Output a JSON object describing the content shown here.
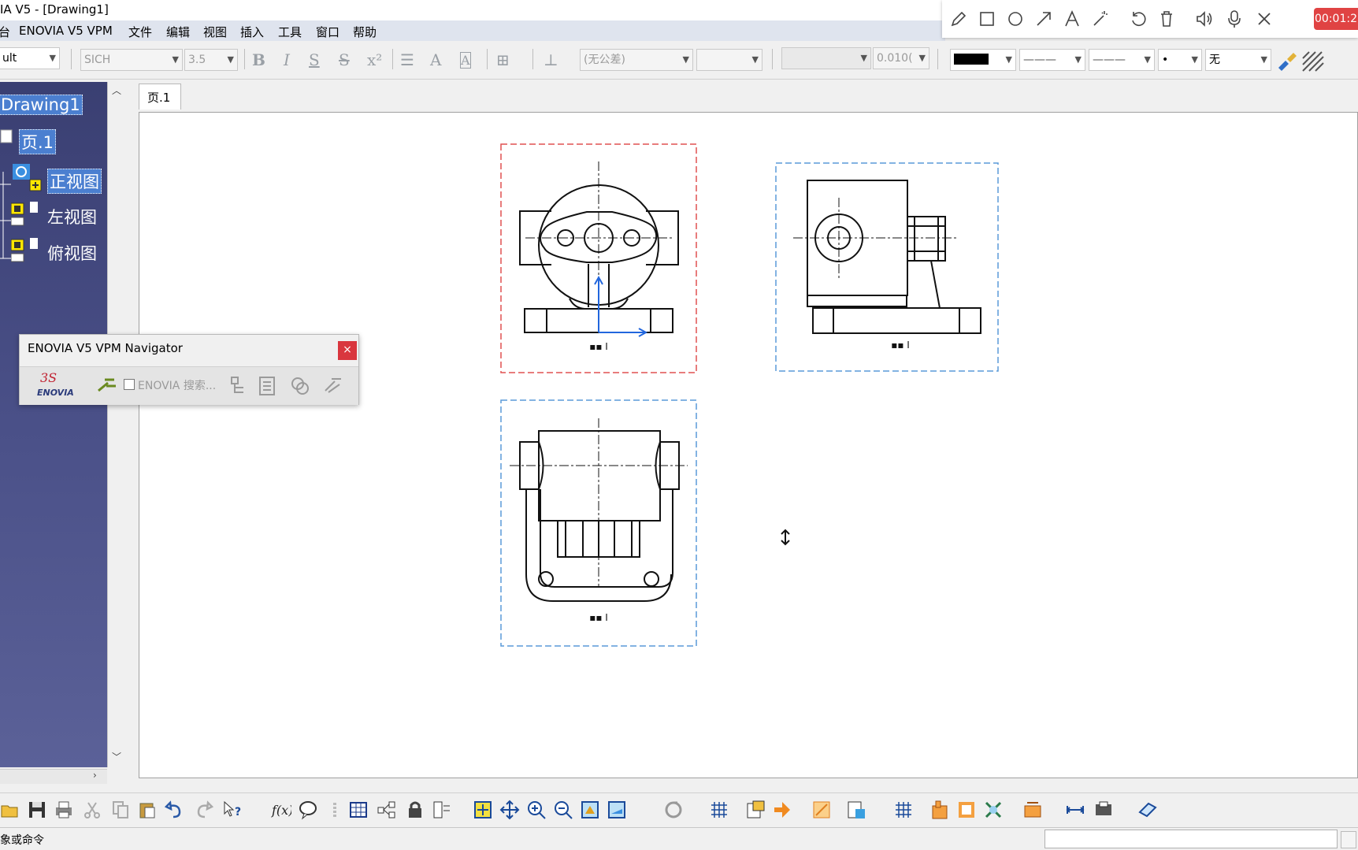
{
  "window": {
    "title": "IA V5 - [Drawing1]"
  },
  "menu": {
    "items": [
      "台",
      "ENOVIA V5 VPM",
      "文件",
      "编辑",
      "视图",
      "插入",
      "工具",
      "窗口",
      "帮助"
    ]
  },
  "recorder": {
    "timer": "00:01:2"
  },
  "format_toolbar": {
    "style_value": "ult",
    "font_name": "SICH",
    "font_size": "3.5",
    "tolerance": "(无公差)",
    "precision": "0.010(",
    "color": "#000000",
    "line_type": "———",
    "line_weight": "———",
    "point_type": "•",
    "pattern": "无"
  },
  "tree": {
    "root": "Drawing1",
    "sheet": "页.1",
    "views": [
      "正视图",
      "左视图",
      "俯视图"
    ]
  },
  "sheet_tab": "页.1",
  "navigator": {
    "title": "ENOVIA V5 VPM Navigator",
    "close": "×",
    "search_label": "ENOVIA 搜索...",
    "logo_text": "ENOVIA"
  },
  "status": {
    "prompt": "象或命令"
  }
}
